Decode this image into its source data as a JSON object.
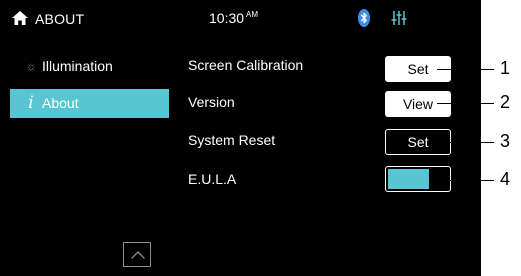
{
  "status_bar": {
    "title": "ABOUT",
    "time": "10:30",
    "ampm": "AM",
    "icons": [
      "home-icon",
      "bluetooth-icon",
      "equalizer-icon"
    ],
    "bluetooth_color": "#3a8ee6",
    "equalizer_color": "#58c6d2"
  },
  "sidebar": {
    "items": [
      {
        "label": "Illumination",
        "icon": "sun-icon",
        "active": false
      },
      {
        "label": "About",
        "icon": "info-icon",
        "active": true
      }
    ],
    "accent": "#58c6d2"
  },
  "rows": [
    {
      "label": "Screen Calibration",
      "button": "Set"
    },
    {
      "label": "Version",
      "button": "View"
    },
    {
      "label": "System Reset",
      "button": "Set"
    },
    {
      "label": "E.U.L.A",
      "toggle_on": true
    }
  ],
  "callouts": [
    "1",
    "2",
    "3",
    "4"
  ]
}
